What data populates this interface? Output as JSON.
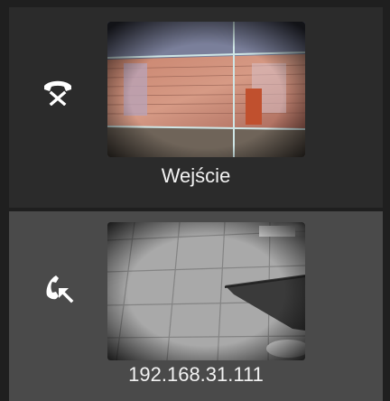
{
  "entries": [
    {
      "label": "Wejście",
      "status_icon": "hangup-icon",
      "selected": false
    },
    {
      "label": "192.168.31.111",
      "status_icon": "incoming-call-icon",
      "selected": true
    }
  ],
  "colors": {
    "background": "#1f1f1f",
    "entry_bg": "#2b2b2b",
    "entry_selected_bg": "#4a4a4a",
    "text": "#f2f2f2"
  }
}
